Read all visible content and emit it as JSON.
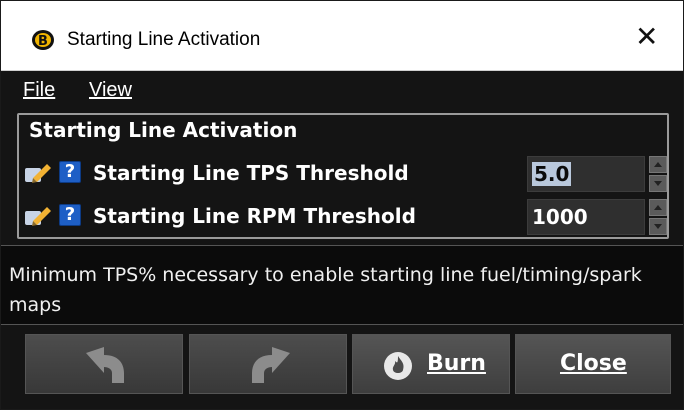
{
  "window": {
    "title": "Starting Line Activation",
    "close_symbol": "✕"
  },
  "menu": {
    "file": "File",
    "view": "View"
  },
  "group": {
    "title": "Starting Line Activation"
  },
  "rows": [
    {
      "label": "Starting Line TPS Threshold",
      "value": "5.0"
    },
    {
      "label": "Starting Line RPM Threshold",
      "value": "1000"
    }
  ],
  "description": "Minimum TPS% necessary to enable starting line fuel/timing/spark maps",
  "buttons": {
    "burn": "Burn",
    "close": "Close"
  },
  "help_symbol": "?",
  "icons": [
    "app-logo-icon",
    "pen-icon",
    "help-icon",
    "undo-icon",
    "redo-icon",
    "flame-icon",
    "spin-up-icon",
    "spin-down-icon"
  ]
}
